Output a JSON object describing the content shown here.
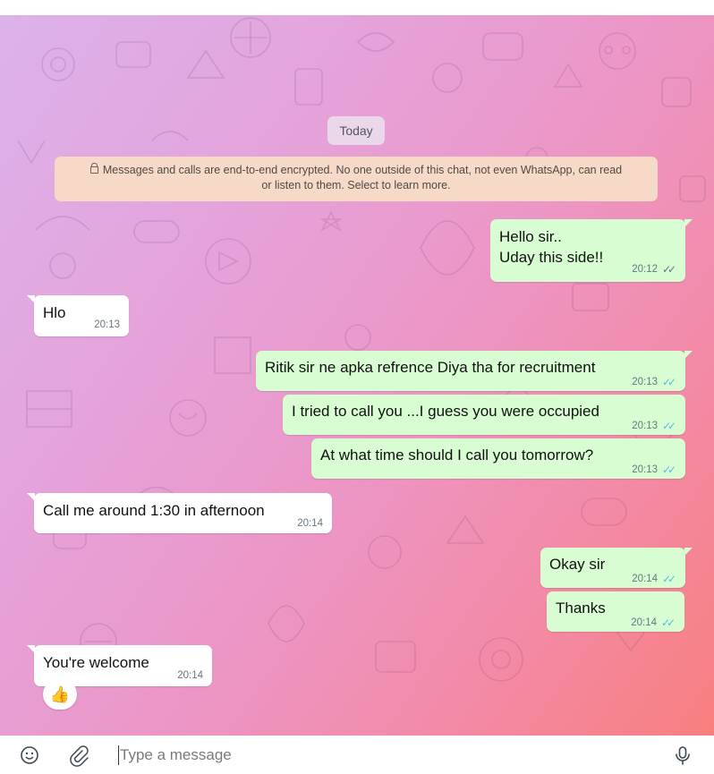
{
  "date_separator": "Today",
  "encryption_notice": {
    "line1": "Messages and calls are end-to-end encrypted. No one outside of this chat, not even WhatsApp, can read",
    "line2": "or listen to them. Select to learn more."
  },
  "messages": [
    {
      "direction": "outgoing",
      "lines": [
        "Hello sir..",
        "Uday this side!!"
      ],
      "time": "20:12",
      "status": "delivered"
    },
    {
      "direction": "incoming",
      "lines": [
        "Hlo"
      ],
      "time": "20:13"
    },
    {
      "direction": "outgoing",
      "lines": [
        "Ritik sir ne apka refrence Diya tha for recruitment"
      ],
      "time": "20:13",
      "status": "read"
    },
    {
      "direction": "outgoing",
      "lines": [
        "I tried to call you ...I guess you were occupied"
      ],
      "time": "20:13",
      "status": "read"
    },
    {
      "direction": "outgoing",
      "lines": [
        "At what time should I call you tomorrow?"
      ],
      "time": "20:13",
      "status": "read"
    },
    {
      "direction": "incoming",
      "lines": [
        "Call me around 1:30 in afternoon"
      ],
      "time": "20:14"
    },
    {
      "direction": "outgoing",
      "lines": [
        "Okay sir"
      ],
      "time": "20:14",
      "status": "read"
    },
    {
      "direction": "outgoing",
      "lines": [
        "Thanks"
      ],
      "time": "20:14",
      "status": "read"
    },
    {
      "direction": "incoming",
      "lines": [
        "You're welcome"
      ],
      "time": "20:14",
      "reaction": "👍"
    }
  ],
  "composer": {
    "placeholder": "Type a message",
    "emoji_icon": "emoji-icon",
    "attach_icon": "paperclip-icon",
    "mic_icon": "microphone-icon"
  },
  "colors": {
    "outgoing_bubble": "#d9fdd3",
    "incoming_bubble": "#ffffff",
    "read_tick": "#53bdeb",
    "encryption_note_bg": "#f7d9c8"
  }
}
